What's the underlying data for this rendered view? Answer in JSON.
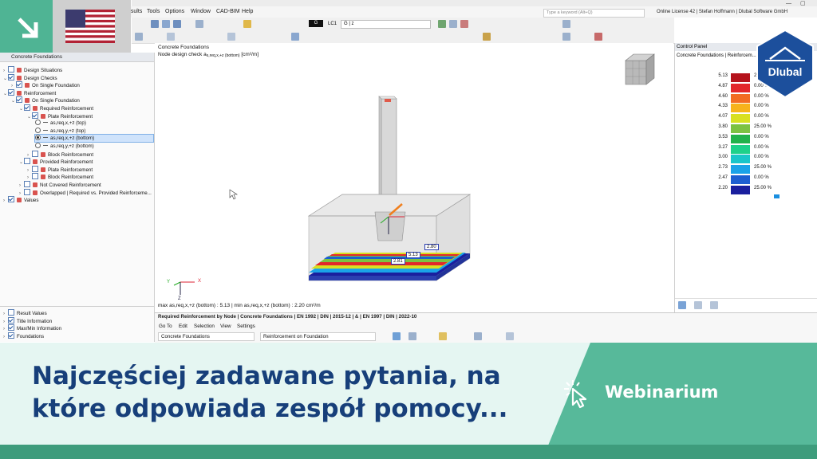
{
  "window": {
    "search_placeholder": "Type a keyword (Alt+Q)",
    "license_text": "Online License 42 | Stefan Hoffmann | Dlubal Software GmbH"
  },
  "menubar": [
    "esults",
    "Tools",
    "Options",
    "Window",
    "CAD-BIM",
    "Help"
  ],
  "toolbar": {
    "loadcase_label": "G",
    "loadcase_id": "LC1",
    "loadcase_name": "G | z"
  },
  "navigator": {
    "title": "Concrete Foundations",
    "tree": [
      {
        "label": "Design Situations",
        "level": 0,
        "checked": false,
        "expand": "closed"
      },
      {
        "label": "Design Checks",
        "level": 0,
        "checked": true,
        "expand": "open"
      },
      {
        "label": "On Single Foundation",
        "level": 1,
        "checked": true,
        "expand": "closed"
      },
      {
        "label": "Reinforcement",
        "level": 0,
        "checked": true,
        "expand": "open"
      },
      {
        "label": "On Single Foundation",
        "level": 1,
        "checked": true,
        "expand": "open"
      },
      {
        "label": "Required Reinforcement",
        "level": 2,
        "checked": true,
        "expand": "open"
      },
      {
        "label": "Plate Reinforcement",
        "level": 3,
        "checked": true,
        "expand": "open"
      },
      {
        "label": "as,req,x,+z (top)",
        "level": 4,
        "radio": true,
        "selected": false
      },
      {
        "label": "as,req,y,+z (top)",
        "level": 4,
        "radio": true,
        "selected": false
      },
      {
        "label": "as,req,x,+z (bottom)",
        "level": 4,
        "radio": true,
        "selected": true
      },
      {
        "label": "as,req,y,+z (bottom)",
        "level": 4,
        "radio": true,
        "selected": false
      },
      {
        "label": "Block Reinforcement",
        "level": 3,
        "checked": false,
        "expand": "closed"
      },
      {
        "label": "Provided Reinforcement",
        "level": 2,
        "checked": false,
        "expand": "open"
      },
      {
        "label": "Plate Reinforcement",
        "level": 3,
        "checked": false,
        "expand": "closed"
      },
      {
        "label": "Block Reinforcement",
        "level": 3,
        "checked": false,
        "expand": "closed"
      },
      {
        "label": "Not Covered Reinforcement",
        "level": 2,
        "checked": false,
        "expand": "closed"
      },
      {
        "label": "Overlapped | Required vs. Provided Reinforceme...",
        "level": 2,
        "checked": false,
        "expand": "closed"
      },
      {
        "label": "Values",
        "level": 0,
        "checked": true,
        "expand": "closed"
      }
    ],
    "bottom_items": [
      {
        "label": "Result Values",
        "checked": false
      },
      {
        "label": "Title Information",
        "checked": true
      },
      {
        "label": "Max/Min Information",
        "checked": true
      },
      {
        "label": "Foundations",
        "checked": true
      }
    ]
  },
  "viewport": {
    "title": "Concrete Foundations",
    "subtitle_prefix": "Node design check a",
    "subtitle_sub": "s,req,x,+z (bottom)",
    "subtitle_unit": "[cm²/m]",
    "maxmin_text": "max as,req,x,+z (bottom) : 5.13 | min as,req,x,+z (bottom) : 2.20 cm²/m",
    "value_labels": [
      "5.13",
      "2.80",
      "2.81"
    ],
    "axis_labels": {
      "x": "X",
      "y": "Y",
      "z": "Z"
    }
  },
  "control_panel": {
    "title": "Control Panel",
    "subtitle": "Concrete Foundations | Reinforcem...",
    "legend": [
      {
        "value": "5.13",
        "color": "#b5121b",
        "pct": "25.00 %"
      },
      {
        "value": "4.87",
        "color": "#e3262b",
        "pct": "0.00 %"
      },
      {
        "value": "4.60",
        "color": "#f26c22",
        "pct": "0.00 %"
      },
      {
        "value": "4.33",
        "color": "#f7b31b",
        "pct": "0.00 %"
      },
      {
        "value": "4.07",
        "color": "#d9e021",
        "pct": "0.00 %"
      },
      {
        "value": "3.80",
        "color": "#7cc242",
        "pct": "25.00 %"
      },
      {
        "value": "3.53",
        "color": "#21b24b",
        "pct": "0.00 %"
      },
      {
        "value": "3.27",
        "color": "#1dd18a",
        "pct": "0.00 %"
      },
      {
        "value": "3.00",
        "color": "#19c6c9",
        "pct": "0.00 %"
      },
      {
        "value": "2.73",
        "color": "#1aa3e8",
        "pct": "25.00 %"
      },
      {
        "value": "2.47",
        "color": "#1d5fd1",
        "pct": "0.00 %"
      },
      {
        "value": "2.20",
        "color": "#1a1f9e",
        "pct": "25.00 %"
      }
    ]
  },
  "results": {
    "title": "Required Reinforcement by Node | Concrete Foundations | EN 1992 | DIN | 2015-12 | & | EN 1997 | DIN | 2022-10",
    "menu": [
      "Go To",
      "Edit",
      "Selection",
      "View",
      "Settings"
    ],
    "select_left": "Concrete Foundations",
    "select_right": "Reinforcement on Foundation"
  },
  "banner": {
    "headline_line1": "Najczęściej zadawane pytania, na",
    "headline_line2": "które odpowiada zespół pomocy...",
    "webinar": "Webinarium",
    "logo_text": "Dlubal"
  },
  "colors": {
    "accent_green": "#57b99a",
    "navy": "#173f7a",
    "dlubal_blue": "#1c4f9c"
  }
}
